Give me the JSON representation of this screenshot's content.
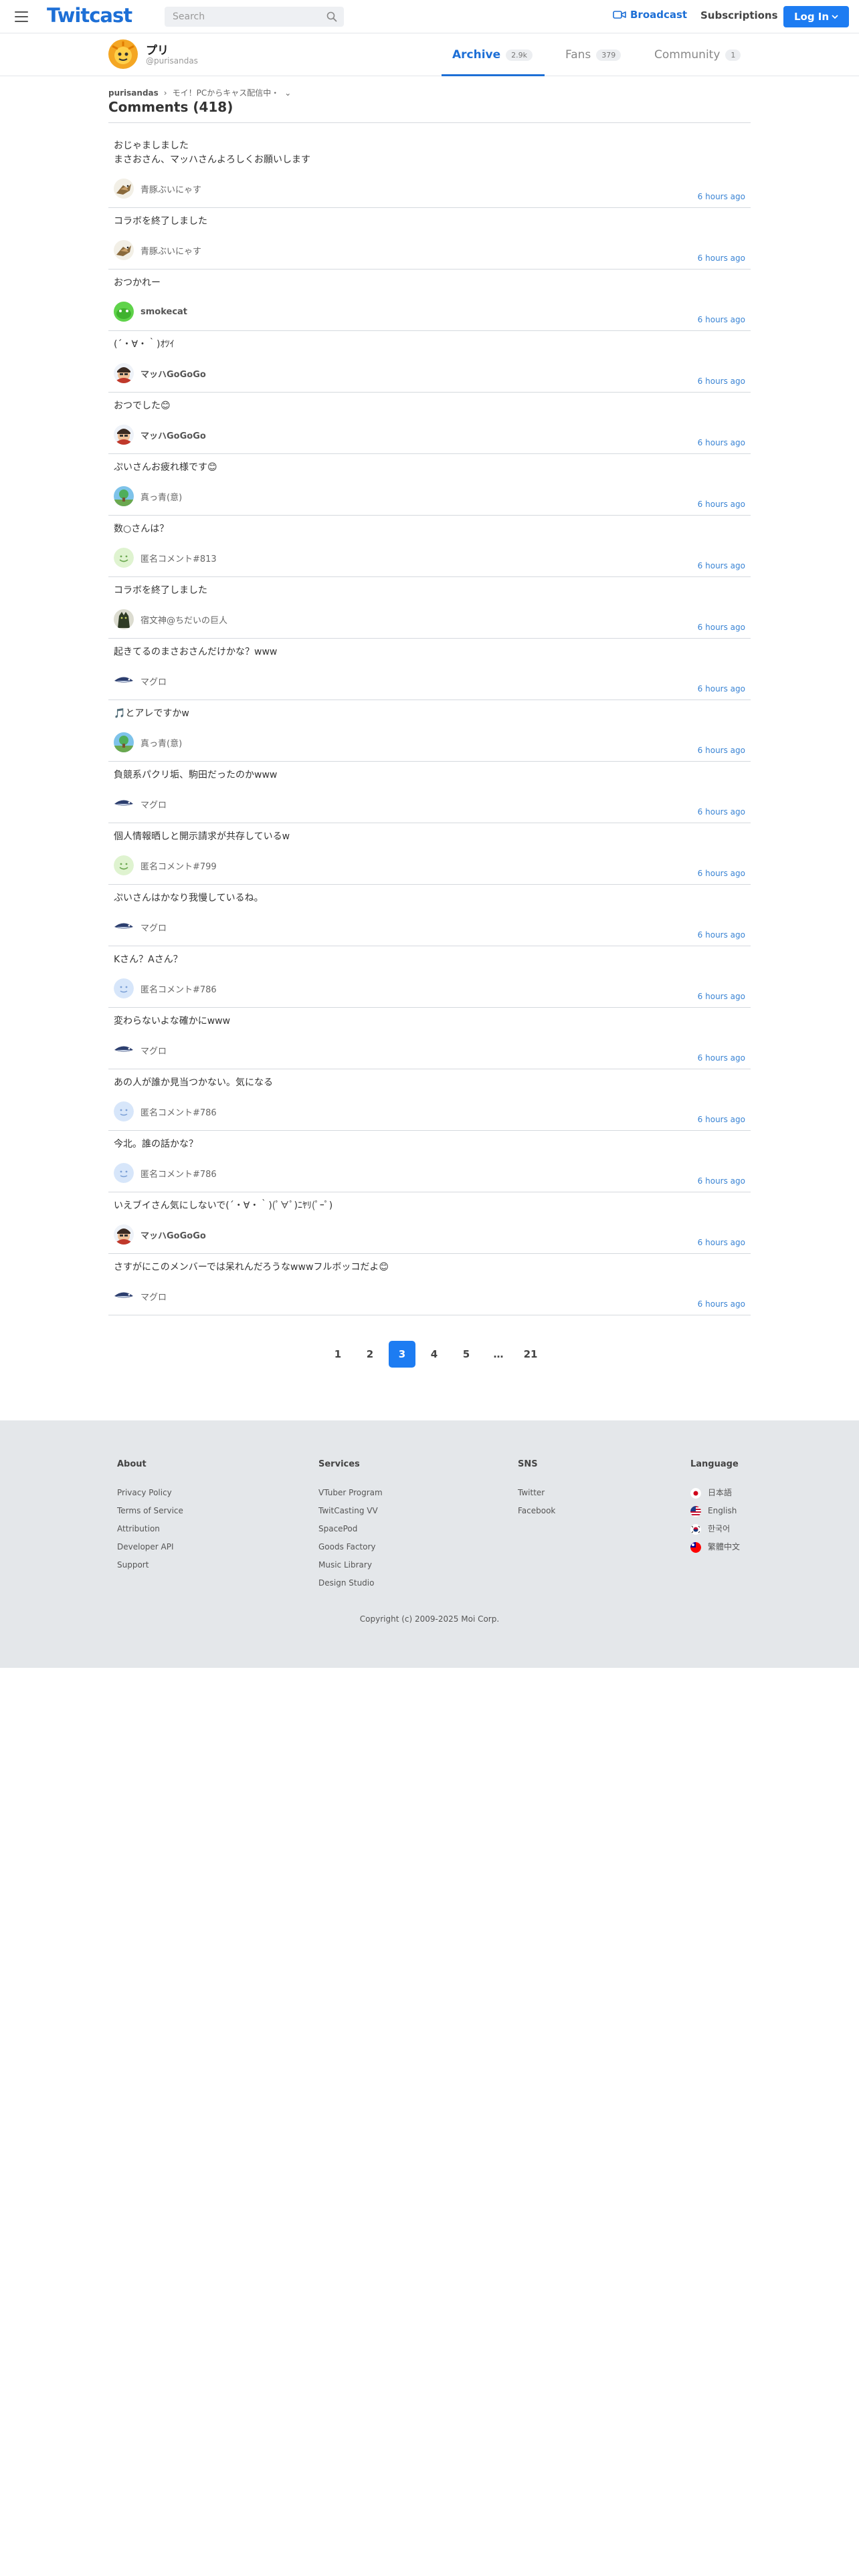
{
  "header": {
    "logo": "Twitcast",
    "search_placeholder": "Search",
    "broadcast": "Broadcast",
    "subscriptions": "Subscriptions",
    "login": "Log In"
  },
  "user": {
    "name": "プリ",
    "handle": "@purisandas",
    "tabs": [
      {
        "label": "Archive",
        "count": "2.9k"
      },
      {
        "label": "Fans",
        "count": "379"
      },
      {
        "label": "Community",
        "count": "1"
      }
    ]
  },
  "breadcrumb": {
    "home": "purisandas",
    "sep": "›",
    "current": "モイ！PCからキャス配信中・",
    "chevron": "⌄"
  },
  "page_title": "Comments (418)",
  "comments": [
    {
      "text": "おじゃましました\nまさおさん、マッハさんよろしくお願いします",
      "author": "青豚ぶいにゃす",
      "avatar": "bird-avatar",
      "time": "6 hours ago",
      "bold": false
    },
    {
      "text": "コラボを終了しました",
      "author": "青豚ぶいにゃす",
      "avatar": "bird-avatar",
      "time": "6 hours ago",
      "bold": false
    },
    {
      "text": "おつかれー",
      "author": "smokecat",
      "avatar": "green-avatar",
      "time": "6 hours ago",
      "bold": true
    },
    {
      "text": "(´・∀・｀)ｵﾂｲ",
      "author": "マッハGoGoGo",
      "avatar": "character-avatar",
      "time": "6 hours ago",
      "bold": true
    },
    {
      "text": "おつでした😊",
      "author": "マッハGoGoGo",
      "avatar": "character-avatar",
      "time": "6 hours ago",
      "bold": true
    },
    {
      "text": "ぷいさんお疲れ様です😊",
      "author": "真っ青(意)",
      "avatar": "landscape-avatar",
      "time": "6 hours ago",
      "bold": false
    },
    {
      "text": "数○さんは？",
      "author": "匿名コメント#813",
      "avatar": "smile-avatar",
      "time": "6 hours ago",
      "bold": false
    },
    {
      "text": "コラボを終了しました",
      "author": "宿文神@ちだいの巨人",
      "avatar": "dark-avatar",
      "time": "6 hours ago",
      "bold": false
    },
    {
      "text": "起きてるのまさおさんだけかな？www",
      "author": "マグロ",
      "avatar": "tuna-avatar",
      "time": "6 hours ago",
      "bold": false
    },
    {
      "text": "🎵とアレですかw",
      "author": "真っ青(意)",
      "avatar": "landscape-avatar",
      "time": "6 hours ago",
      "bold": false
    },
    {
      "text": "負競系パクリ垢、駒田だったのかwww",
      "author": "マグロ",
      "avatar": "tuna-avatar",
      "time": "6 hours ago",
      "bold": false
    },
    {
      "text": "個人情報晒しと開示請求が共存しているw",
      "author": "匿名コメント#799",
      "avatar": "smile-avatar",
      "time": "6 hours ago",
      "bold": false
    },
    {
      "text": "ぷいさんはかなり我慢しているね。",
      "author": "マグロ",
      "avatar": "tuna-avatar",
      "time": "6 hours ago",
      "bold": false
    },
    {
      "text": "Kさん？Aさん？",
      "author": "匿名コメント#786",
      "avatar": "blue-avatar",
      "time": "6 hours ago",
      "bold": false
    },
    {
      "text": "変わらないよな確かにwww",
      "author": "マグロ",
      "avatar": "tuna-avatar",
      "time": "6 hours ago",
      "bold": false
    },
    {
      "text": "あの人が誰か見当つかない。気になる",
      "author": "匿名コメント#786",
      "avatar": "blue-avatar",
      "time": "6 hours ago",
      "bold": false
    },
    {
      "text": "今北。誰の話かな？",
      "author": "匿名コメント#786",
      "avatar": "blue-avatar",
      "time": "6 hours ago",
      "bold": false
    },
    {
      "text": "いえブイさん気にしないで(´・∀・｀)(ﾟ∀ﾟ)ﾆﾔﾘ(ﾟｰﾟ)",
      "author": "マッハGoGoGo",
      "avatar": "character-avatar",
      "time": "6 hours ago",
      "bold": true
    },
    {
      "text": "さすがにこのメンバーでは呆れんだろうなwwwフルボッコだよ😊",
      "author": "マグロ",
      "avatar": "tuna-avatar",
      "time": "6 hours ago",
      "bold": false
    }
  ],
  "pagination": [
    "1",
    "2",
    "3",
    "4",
    "5",
    "…",
    "21"
  ],
  "pagination_current": "3",
  "footer": {
    "about": {
      "title": "About",
      "links": [
        "Privacy Policy",
        "Terms of Service",
        "Attribution",
        "Developer API",
        "Support"
      ]
    },
    "services": {
      "title": "Services",
      "links": [
        "VTuber Program",
        "TwitCasting VV",
        "SpacePod",
        "Goods Factory",
        "Music Library",
        "Design Studio"
      ]
    },
    "sns": {
      "title": "SNS",
      "links": [
        "Twitter",
        "Facebook"
      ]
    },
    "language": {
      "title": "Language",
      "links": [
        "日本語",
        "English",
        "한국어",
        "繁體中文"
      ]
    },
    "copyright": "Copyright (c) 2009-2025 Moi Corp."
  }
}
